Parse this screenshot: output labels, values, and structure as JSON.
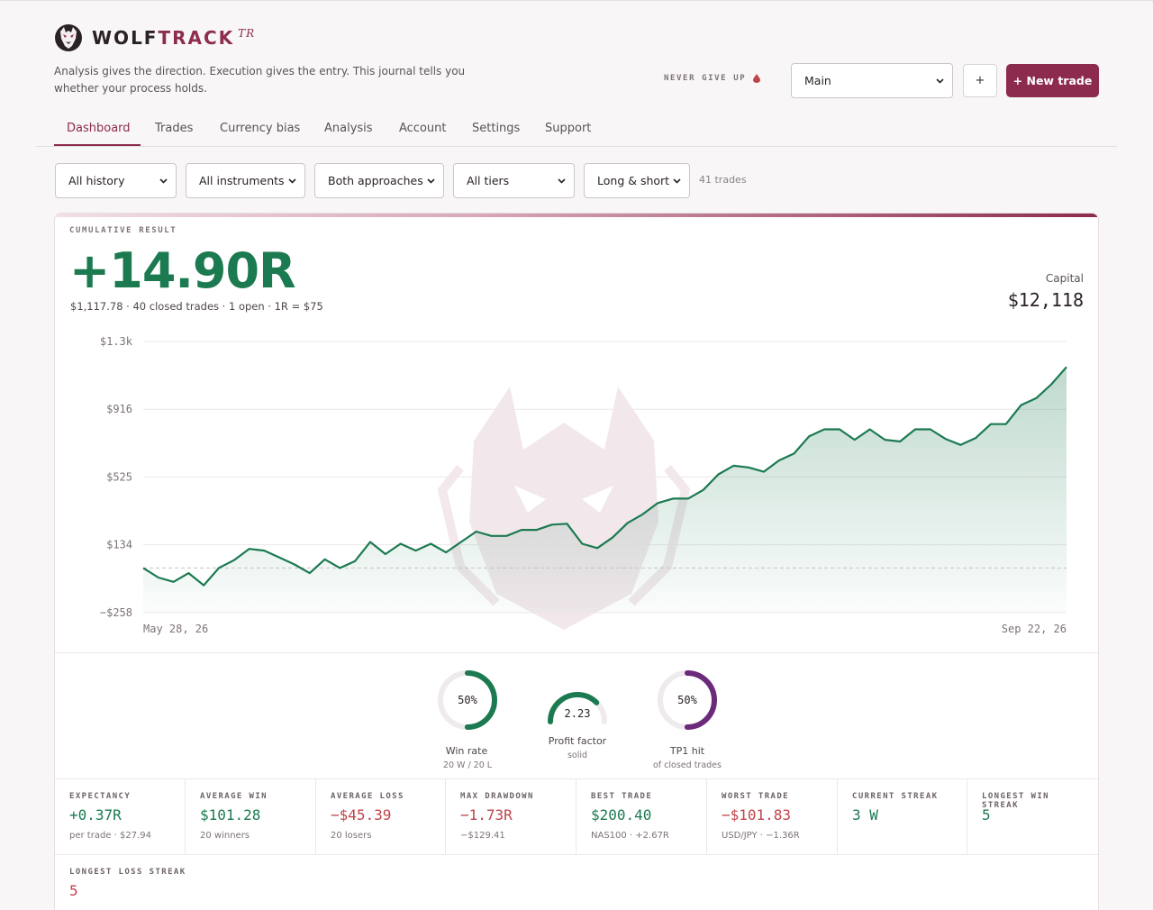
{
  "brand": {
    "name_part1": "WOLF",
    "name_part2": "TRACK",
    "suffix": "TR"
  },
  "tagline": "Analysis gives the direction. Execution gives the entry. This journal tells you whether your process holds.",
  "motto": "NEVER GIVE UP",
  "account_select": {
    "value": "Main"
  },
  "add_account_label": "+",
  "new_trade_label": "+ New trade",
  "tabs": [
    {
      "label": "Dashboard",
      "active": true
    },
    {
      "label": "Trades"
    },
    {
      "label": "Currency bias"
    },
    {
      "label": "Analysis"
    },
    {
      "label": "Account"
    },
    {
      "label": "Settings"
    },
    {
      "label": "Support"
    }
  ],
  "filters": {
    "history": "All history",
    "instruments": "All instruments",
    "approaches": "Both approaches",
    "tiers": "All tiers",
    "direction": "Long & short"
  },
  "trade_count": "41 trades",
  "cumulative": {
    "label": "CUMULATIVE RESULT",
    "value": "+14.90R",
    "summary": "$1,117.78 · 40 closed trades · 1 open · 1R = $75",
    "capital_label": "Capital",
    "capital_value": "$12,118"
  },
  "chart_data": {
    "type": "area",
    "y_tick_labels": [
      "$1.3k",
      "$916",
      "$525",
      "$134",
      "−$258"
    ],
    "y_ticks": [
      1307,
      916,
      525,
      134,
      -258
    ],
    "x_tick_labels": [
      "May 28, 26",
      "Sep 22, 26"
    ],
    "ylim": [
      -258,
      1307
    ],
    "baseline": 0,
    "color": "#1b7a50",
    "values": [
      0,
      -55,
      -80,
      -30,
      -100,
      0,
      45,
      110,
      100,
      60,
      20,
      -30,
      50,
      0,
      40,
      150,
      80,
      140,
      100,
      140,
      90,
      150,
      210,
      185,
      185,
      220,
      220,
      250,
      255,
      140,
      115,
      175,
      260,
      310,
      375,
      400,
      400,
      450,
      540,
      590,
      580,
      555,
      620,
      660,
      760,
      800,
      800,
      740,
      800,
      740,
      730,
      800,
      800,
      745,
      710,
      750,
      830,
      830,
      940,
      980,
      1060,
      1160
    ]
  },
  "gauges": {
    "win_rate": {
      "value": "50%",
      "fraction": 0.5,
      "label": "Win rate",
      "sub": "20 W / 20 L",
      "color": "#1b7a50"
    },
    "profit_factor": {
      "value": "2.23",
      "fraction": 0.75,
      "label": "Profit factor",
      "sub": "solid",
      "color": "#1b7a50"
    },
    "tp1_hit": {
      "value": "50%",
      "fraction": 0.5,
      "label": "TP1 hit",
      "sub": "of closed trades",
      "color": "#6b2a7a"
    }
  },
  "stats": [
    {
      "label": "EXPECTANCY",
      "value": "+0.37R",
      "sub": "per trade · $27.94",
      "tone": "green"
    },
    {
      "label": "AVERAGE WIN",
      "value": "$101.28",
      "sub": "20 winners",
      "tone": "green"
    },
    {
      "label": "AVERAGE LOSS",
      "value": "−$45.39",
      "sub": "20 losers",
      "tone": "red"
    },
    {
      "label": "MAX DRAWDOWN",
      "value": "−1.73R",
      "sub": "−$129.41",
      "tone": "red"
    },
    {
      "label": "BEST TRADE",
      "value": "$200.40",
      "sub": "NAS100 · +2.67R",
      "tone": "green"
    },
    {
      "label": "WORST TRADE",
      "value": "−$101.83",
      "sub": "USD/JPY · −1.36R",
      "tone": "red"
    },
    {
      "label": "CURRENT STREAK",
      "value": "3 W",
      "sub": "",
      "tone": "green"
    },
    {
      "label": "LONGEST WIN STREAK",
      "value": "5",
      "sub": "",
      "tone": "green"
    },
    {
      "label": "LONGEST LOSS STREAK",
      "value": "5",
      "sub": "",
      "tone": "red"
    }
  ]
}
